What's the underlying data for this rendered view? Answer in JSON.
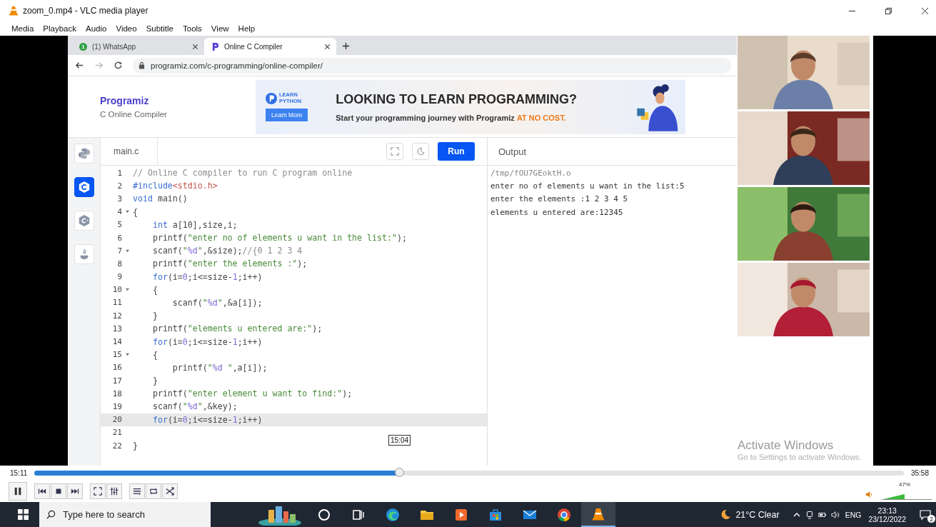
{
  "window": {
    "title": "zoom_0.mp4 - VLC media player"
  },
  "menu": [
    "Media",
    "Playback",
    "Audio",
    "Video",
    "Subtitle",
    "Tools",
    "View",
    "Help"
  ],
  "browser": {
    "tabs": [
      {
        "kind": "whatsapp",
        "badge": "1",
        "title": "(1) WhatsApp",
        "selected": false
      },
      {
        "kind": "programiz",
        "title": "Online C Compiler",
        "selected": true
      }
    ],
    "forward_disabled": true,
    "url": "programiz.com/c-programming/online-compiler/"
  },
  "site": {
    "logo": "Programiz",
    "subtitle": "C Online Compiler"
  },
  "ad": {
    "badge": "LEARN PYTHON",
    "button": "Learn More",
    "headline": "LOOKING TO LEARN PROGRAMMING?",
    "text": "Start your programming journey with Programiz ",
    "highlight": "AT NO COST."
  },
  "languages": [
    {
      "kind": "python",
      "selected": false
    },
    {
      "kind": "c",
      "selected": true
    },
    {
      "kind": "cpp",
      "selected": false
    },
    {
      "kind": "java",
      "selected": false
    }
  ],
  "editor": {
    "file": "main.c",
    "run": "Run",
    "lines": [
      {
        "n": "1",
        "fold": false,
        "active": false,
        "tokens": [
          {
            "kind": "cm",
            "text": "// Online C compiler to run C program online"
          }
        ]
      },
      {
        "n": "2",
        "fold": false,
        "active": false,
        "tokens": [
          {
            "kind": "kw",
            "text": "#include"
          },
          {
            "kind": "inc",
            "text": "<stdio.h>"
          }
        ]
      },
      {
        "n": "3",
        "fold": false,
        "active": false,
        "tokens": [
          {
            "kind": "kw",
            "text": "void"
          },
          {
            "kind": "pl",
            "text": " main()"
          }
        ]
      },
      {
        "n": "4",
        "fold": true,
        "active": false,
        "tokens": [
          {
            "kind": "pl",
            "text": "{"
          }
        ]
      },
      {
        "n": "5",
        "fold": false,
        "active": false,
        "tokens": [
          {
            "kind": "kw",
            "text": "    int"
          },
          {
            "kind": "pl",
            "text": " a[10],size,i;"
          }
        ]
      },
      {
        "n": "6",
        "fold": false,
        "active": false,
        "tokens": [
          {
            "kind": "pl",
            "text": "    printf("
          },
          {
            "kind": "str",
            "text": "\"enter no of elements u want in the list:\""
          },
          {
            "kind": "pl",
            "text": ");"
          }
        ]
      },
      {
        "n": "7",
        "fold": true,
        "active": false,
        "tokens": [
          {
            "kind": "pl",
            "text": "    scanf("
          },
          {
            "kind": "str",
            "text": "\""
          },
          {
            "kind": "fmt",
            "text": "%d"
          },
          {
            "kind": "str",
            "text": "\""
          },
          {
            "kind": "pl",
            "text": ",&size);"
          },
          {
            "kind": "cm",
            "text": "//{0 1 2 3 4"
          }
        ]
      },
      {
        "n": "8",
        "fold": false,
        "active": false,
        "tokens": [
          {
            "kind": "pl",
            "text": "    printf("
          },
          {
            "kind": "str",
            "text": "\"enter the elements :\""
          },
          {
            "kind": "pl",
            "text": ");"
          }
        ]
      },
      {
        "n": "9",
        "fold": false,
        "active": false,
        "tokens": [
          {
            "kind": "kw",
            "text": "    for"
          },
          {
            "kind": "pl",
            "text": "(i="
          },
          {
            "kind": "num",
            "text": "0"
          },
          {
            "kind": "pl",
            "text": ";i<=size-"
          },
          {
            "kind": "num",
            "text": "1"
          },
          {
            "kind": "pl",
            "text": ";i++)"
          }
        ]
      },
      {
        "n": "10",
        "fold": true,
        "active": false,
        "tokens": [
          {
            "kind": "pl",
            "text": "    {"
          }
        ]
      },
      {
        "n": "11",
        "fold": false,
        "active": false,
        "tokens": [
          {
            "kind": "pl",
            "text": "        scanf("
          },
          {
            "kind": "str",
            "text": "\""
          },
          {
            "kind": "fmt",
            "text": "%d"
          },
          {
            "kind": "str",
            "text": "\""
          },
          {
            "kind": "pl",
            "text": ",&a[i]);"
          }
        ]
      },
      {
        "n": "12",
        "fold": false,
        "active": false,
        "tokens": [
          {
            "kind": "pl",
            "text": "    }"
          }
        ]
      },
      {
        "n": "13",
        "fold": false,
        "active": false,
        "tokens": [
          {
            "kind": "pl",
            "text": "    printf("
          },
          {
            "kind": "str",
            "text": "\"elements u entered are:\""
          },
          {
            "kind": "pl",
            "text": ");"
          }
        ]
      },
      {
        "n": "14",
        "fold": false,
        "active": false,
        "tokens": [
          {
            "kind": "kw",
            "text": "    for"
          },
          {
            "kind": "pl",
            "text": "(i="
          },
          {
            "kind": "num",
            "text": "0"
          },
          {
            "kind": "pl",
            "text": ";i<=size-"
          },
          {
            "kind": "num",
            "text": "1"
          },
          {
            "kind": "pl",
            "text": ";i++)"
          }
        ]
      },
      {
        "n": "15",
        "fold": true,
        "active": false,
        "tokens": [
          {
            "kind": "pl",
            "text": "    {"
          }
        ]
      },
      {
        "n": "16",
        "fold": false,
        "active": false,
        "tokens": [
          {
            "kind": "pl",
            "text": "        printf("
          },
          {
            "kind": "str",
            "text": "\""
          },
          {
            "kind": "fmt",
            "text": "%d "
          },
          {
            "kind": "str",
            "text": "\""
          },
          {
            "kind": "pl",
            "text": ",a[i]);"
          }
        ]
      },
      {
        "n": "17",
        "fold": false,
        "active": false,
        "tokens": [
          {
            "kind": "pl",
            "text": "    }"
          }
        ]
      },
      {
        "n": "18",
        "fold": false,
        "active": false,
        "tokens": [
          {
            "kind": "pl",
            "text": "    printf("
          },
          {
            "kind": "str",
            "text": "\"enter element u want to find:\""
          },
          {
            "kind": "pl",
            "text": ");"
          }
        ]
      },
      {
        "n": "19",
        "fold": false,
        "active": false,
        "tokens": [
          {
            "kind": "pl",
            "text": "    scanf("
          },
          {
            "kind": "str",
            "text": "\""
          },
          {
            "kind": "fmt",
            "text": "%d"
          },
          {
            "kind": "str",
            "text": "\""
          },
          {
            "kind": "pl",
            "text": ",&key);"
          }
        ]
      },
      {
        "n": "20",
        "fold": false,
        "active": true,
        "tokens": [
          {
            "kind": "kw",
            "text": "    for"
          },
          {
            "kind": "pl",
            "text": "(i="
          },
          {
            "kind": "num",
            "text": "0"
          },
          {
            "kind": "pl",
            "text": ";i<=size-"
          },
          {
            "kind": "num",
            "text": "1"
          },
          {
            "kind": "pl",
            "text": ";i++)"
          }
        ]
      },
      {
        "n": "21",
        "fold": false,
        "active": false
      },
      {
        "n": "22",
        "fold": false,
        "active": false,
        "tokens": [
          {
            "kind": "pl",
            "text": "}"
          }
        ]
      }
    ]
  },
  "output": {
    "title": "Output",
    "lines": [
      {
        "kind": "path",
        "text": "/tmp/fOU7GEoktH.o"
      },
      {
        "kind": "text",
        "text": "enter no of elements u want in the list:5"
      },
      {
        "kind": "text",
        "text": "enter the elements :1 2 3 4 5"
      },
      {
        "kind": "text",
        "text": "elements u entered are:12345"
      }
    ]
  },
  "seek_tooltip": "15:04",
  "videos": [
    {
      "kind": "picture"
    },
    {
      "kind": "picture"
    },
    {
      "kind": "picture"
    },
    {
      "kind": "picture"
    }
  ],
  "activation": {
    "title": "Activate Windows",
    "text": "Go to Settings to activate Windows."
  },
  "player": {
    "elapsed": "15:11",
    "total": "35:58",
    "level": 0.42,
    "playing": true,
    "volume": {
      "level": 0.47,
      "text": "47%"
    }
  },
  "taskbar": {
    "search": "Type here to search",
    "apps": [
      {
        "kind": "cortana",
        "active": false
      },
      {
        "kind": "taskview",
        "active": false
      },
      {
        "kind": "edge",
        "active": false
      },
      {
        "kind": "explorer",
        "active": false
      },
      {
        "kind": "media",
        "active": false
      },
      {
        "kind": "store",
        "active": false
      },
      {
        "kind": "mail",
        "active": false
      },
      {
        "kind": "chrome",
        "active": false
      },
      {
        "kind": "vlc",
        "active": true
      }
    ],
    "weather": "21°C Clear",
    "lang": "ENG",
    "time": "23:13",
    "date": "23/12/2022",
    "notifications": "2"
  }
}
